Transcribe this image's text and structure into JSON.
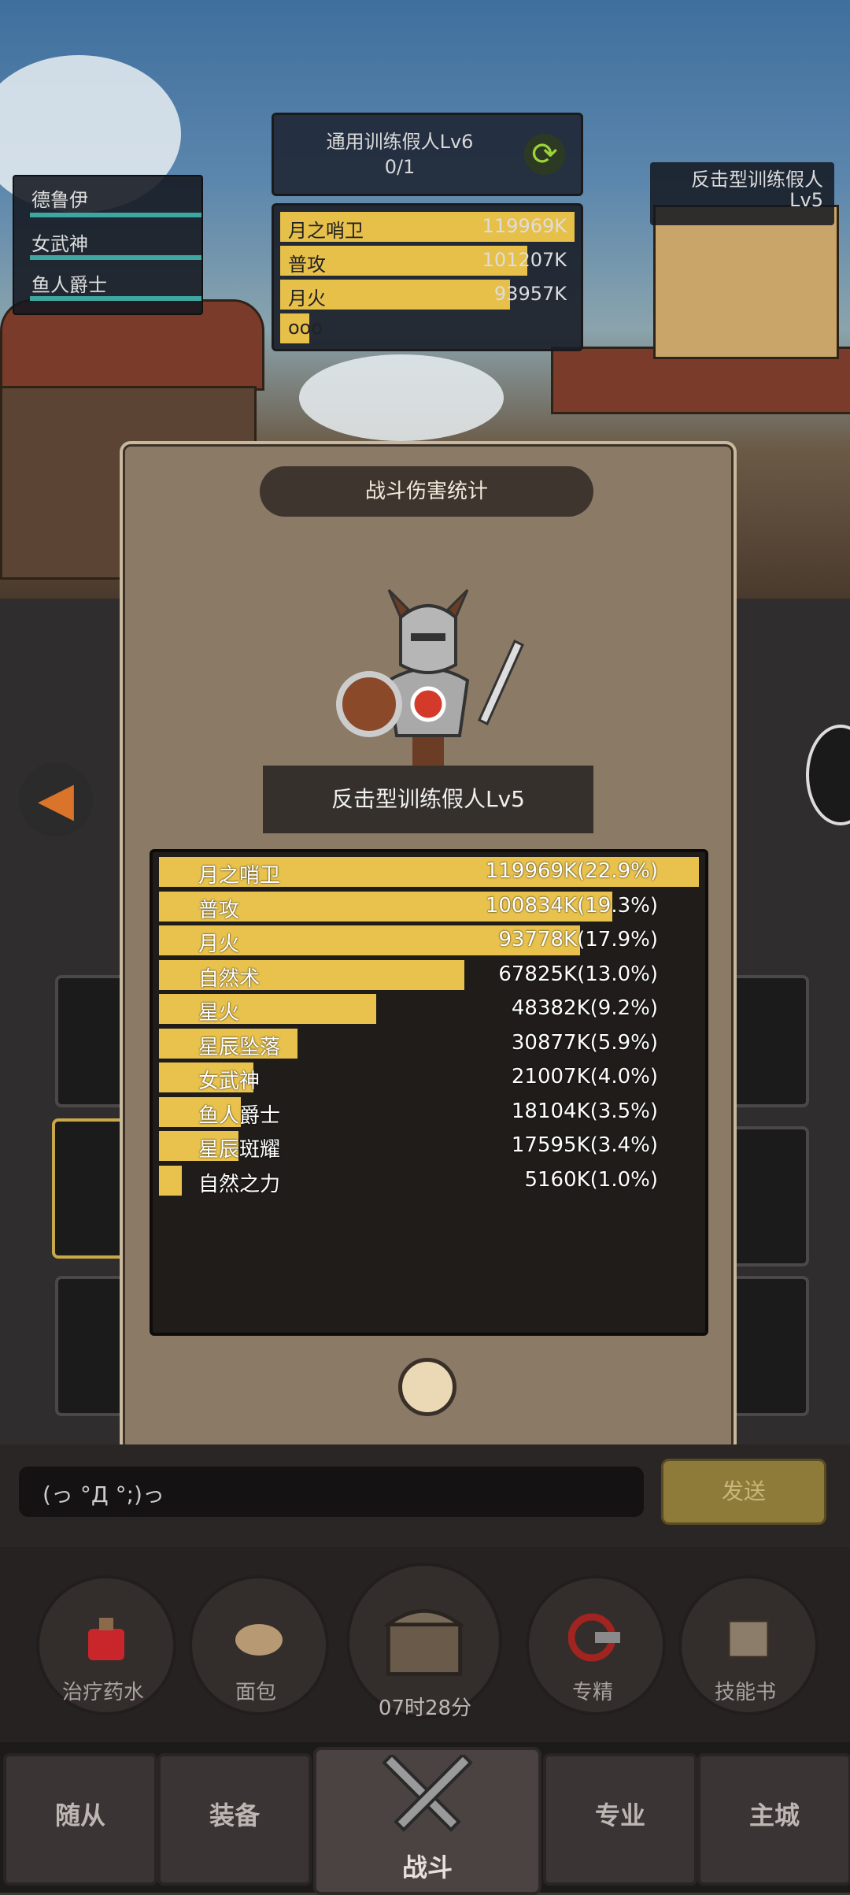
{
  "scene": {
    "boss": {
      "name": "通用训练假人Lv6",
      "count": "0/1"
    },
    "mini_stats": [
      {
        "name": "月之哨卫",
        "value": "119969K",
        "fill": 1.0
      },
      {
        "name": "普攻",
        "value": "101207K",
        "fill": 0.84
      },
      {
        "name": "月火",
        "value": "93957K",
        "fill": 0.78
      },
      {
        "name": "ooo",
        "value": "",
        "fill": 0.1
      }
    ],
    "party": [
      "德鲁伊",
      "女武神",
      "鱼人爵士"
    ],
    "enemy_label": {
      "line1": "反击型训练假人",
      "line2": "Lv5"
    }
  },
  "modal": {
    "title": "战斗伤害统计",
    "target": "反击型训练假人Lv5",
    "rows": [
      {
        "name": "月之哨卫",
        "value": "119969K(22.9%)",
        "share": 1.0
      },
      {
        "name": "普攻",
        "value": "100834K(19.3%)",
        "share": 0.84
      },
      {
        "name": "月火",
        "value": "93778K(17.9%)",
        "share": 0.78
      },
      {
        "name": "自然术",
        "value": "67825K(13.0%)",
        "share": 0.565
      },
      {
        "name": "星火",
        "value": "48382K(9.2%)",
        "share": 0.403
      },
      {
        "name": "星辰坠落",
        "value": "30877K(5.9%)",
        "share": 0.257
      },
      {
        "name": "女武神",
        "value": "21007K(4.0%)",
        "share": 0.175
      },
      {
        "name": "鱼人爵士",
        "value": "18104K(3.5%)",
        "share": 0.151
      },
      {
        "name": "星辰斑耀",
        "value": "17595K(3.4%)",
        "share": 0.147
      },
      {
        "name": "自然之力",
        "value": "5160K(1.0%)",
        "share": 0.043
      }
    ]
  },
  "chat": {
    "input_text": "(っ °Д °;)っ",
    "send_label": "发送"
  },
  "actions": [
    {
      "label": "治疗药水",
      "icon": "potion-icon"
    },
    {
      "label": "面包",
      "icon": "bread-icon"
    },
    {
      "label": "",
      "icon": "treasure-chest-icon"
    },
    {
      "label": "专精",
      "icon": "specialization-icon"
    },
    {
      "label": "技能书",
      "icon": "skill-book-icon"
    }
  ],
  "timer": "07时28分",
  "nav": {
    "followers": "随从",
    "equipment": "装备",
    "battle": "战斗",
    "profession": "专业",
    "city": "主城"
  },
  "colors": {
    "bar": "#e8c24c",
    "modal": "#8a7a66",
    "panel": "#1f1c19"
  }
}
